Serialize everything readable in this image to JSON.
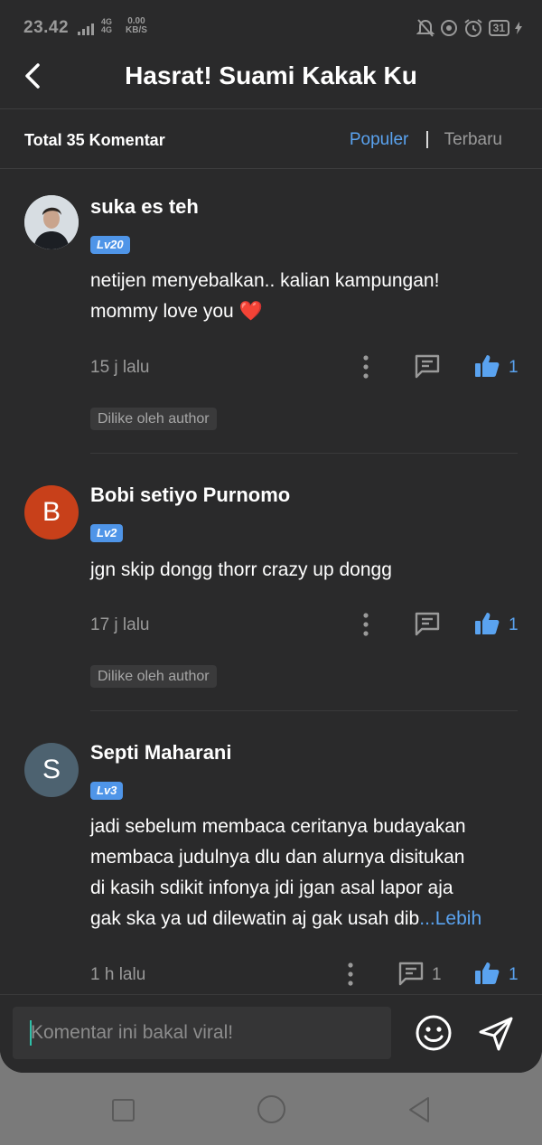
{
  "status_bar": {
    "time": "23.42",
    "network_top": "4G",
    "network_bottom": "4G",
    "speed_value": "0.00",
    "speed_unit": "KB/S",
    "battery": "31"
  },
  "header": {
    "title": "Hasrat! Suami Kakak Ku"
  },
  "subheader": {
    "total": "Total 35 Komentar",
    "sort_popular": "Populer",
    "sort_separator": "|",
    "sort_newest": "Terbaru"
  },
  "comments": [
    {
      "username": "suka es teh",
      "level": "Lv20",
      "avatar_letter": "",
      "text_line1": "netijen menyebalkan.. kalian kampungan!",
      "text_line2": "mommy love you ❤️",
      "time": "15 j lalu",
      "likes": "1",
      "liked_by": "Dilike oleh author"
    },
    {
      "username": "Bobi setiyo Purnomo",
      "level": "Lv2",
      "avatar_letter": "B",
      "avatar_color": "#c8401a",
      "text_line1": "jgn skip dongg thorr crazy up dongg",
      "time": "17 j lalu",
      "likes": "1",
      "liked_by": "Dilike oleh author"
    },
    {
      "username": "Septi Maharani",
      "level": "Lv3",
      "avatar_letter": "S",
      "avatar_color": "#4d6270",
      "text_line1": "jadi sebelum membaca ceritanya budayakan",
      "text_line2": "membaca judulnya dlu dan alurnya disitukan",
      "text_line3": "di kasih sdikit infonya jdi jgan asal lapor aja",
      "text_line4": "gak ska ya ud dilewatin aj gak usah dib",
      "more_label": "...Lebih",
      "time": "1 h lalu",
      "replies": "1",
      "likes": "1"
    }
  ],
  "input_bar": {
    "placeholder": "Komentar ini bakal viral!"
  },
  "icons": {
    "back": "chevron-left-icon",
    "options": "vertical-dots-icon",
    "reply": "comment-bubble-icon",
    "like": "thumbs-up-icon",
    "emoji": "smiley-icon",
    "send": "paper-plane-icon"
  },
  "colors": {
    "background": "#2a2a2b",
    "accent": "#5aa3f0",
    "level_badge": "#4f95e8"
  }
}
